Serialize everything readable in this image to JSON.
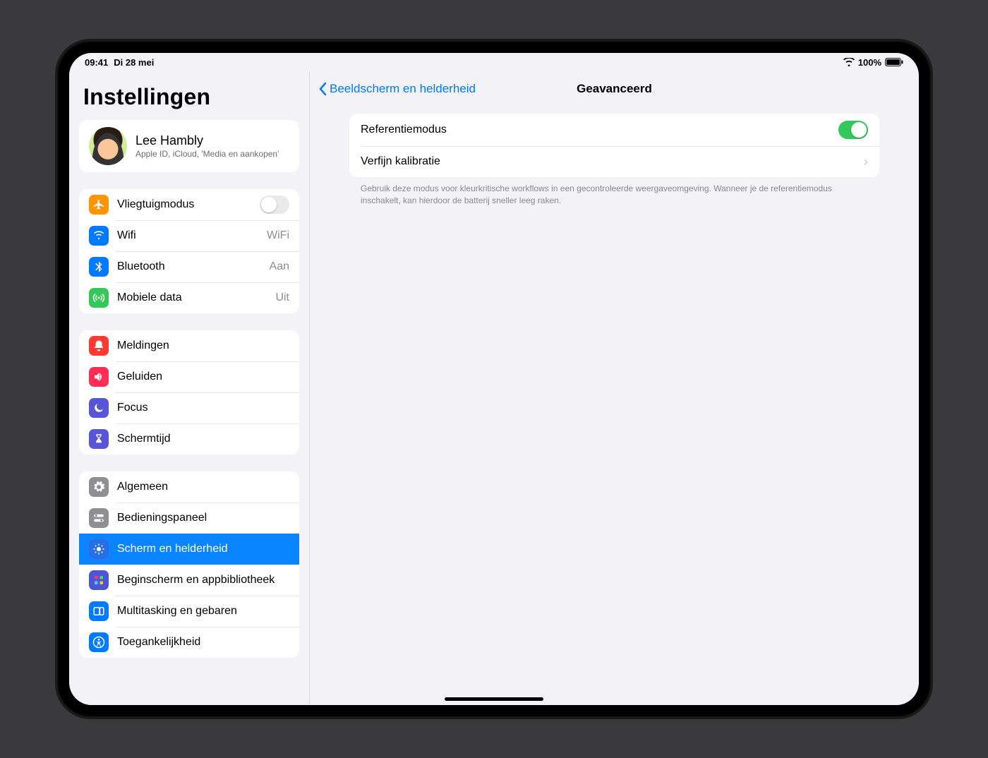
{
  "status": {
    "time": "09:41",
    "date": "Di 28 mei",
    "battery": "100%"
  },
  "sidebar": {
    "title": "Instellingen",
    "profile": {
      "name": "Lee Hambly",
      "sub": "Apple ID, iCloud, 'Media en aankopen'"
    },
    "g1": {
      "airplane": "Vliegtuigmodus",
      "wifi": "Wifi",
      "wifi_val": "WiFi",
      "bt": "Bluetooth",
      "bt_val": "Aan",
      "cell": "Mobiele data",
      "cell_val": "Uit"
    },
    "g2": {
      "notif": "Meldingen",
      "sound": "Geluiden",
      "focus": "Focus",
      "st": "Schermtijd"
    },
    "g3": {
      "gen": "Algemeen",
      "cc": "Bedieningspaneel",
      "disp": "Scherm en helderheid",
      "home": "Beginscherm en appbibliotheek",
      "multi": "Multitasking en gebaren",
      "acc": "Toegankelijkheid"
    }
  },
  "detail": {
    "back": "Beeldscherm en helderheid",
    "title": "Geavanceerd",
    "ref": "Referentiemodus",
    "cal": "Verfijn kalibratie",
    "footer": "Gebruik deze modus voor kleurkritische workflows in een gecontroleerde weergaveomgeving. Wanneer je de referentiemodus inschakelt, kan hierdoor de batterij sneller leeg raken."
  }
}
